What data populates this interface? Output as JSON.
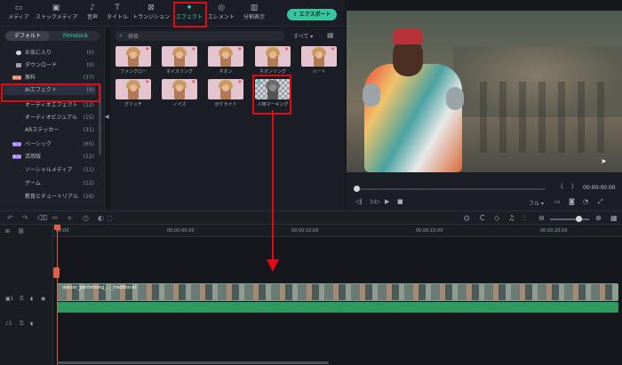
{
  "toolbar": {
    "items": [
      {
        "label": "メディア",
        "icon": "media-icon"
      },
      {
        "label": "ストックメディア",
        "icon": "stock-media-icon"
      },
      {
        "label": "音声",
        "icon": "audio-icon"
      },
      {
        "label": "タイトル",
        "icon": "title-icon"
      },
      {
        "label": "トランジション",
        "icon": "transition-icon"
      },
      {
        "label": "エフェクト",
        "icon": "effects-icon"
      },
      {
        "label": "エレメント",
        "icon": "elements-icon"
      },
      {
        "label": "分割表示",
        "icon": "split-screen-icon"
      }
    ],
    "active": "エフェクト",
    "export_label": "エクスポート"
  },
  "left_panel": {
    "tabs": [
      "デフォルト",
      "Filmstock"
    ],
    "categories": [
      {
        "name": "お気に入り",
        "count": "(0)"
      },
      {
        "name": "ダウンロード",
        "count": "(0)"
      },
      {
        "name": "無料",
        "count": "(37)",
        "badge": "NEW"
      },
      {
        "name": "AIエフェクト",
        "count": "(9)",
        "selected": true
      },
      {
        "name": "オーディオエフェクト",
        "count": "(12)"
      },
      {
        "name": "オーディオビジュアル",
        "count": "(15)"
      },
      {
        "name": "ARステッカー",
        "count": "(31)"
      },
      {
        "name": "ベーシック",
        "count": "(65)",
        "badge": "NEW"
      },
      {
        "name": "活用版",
        "count": "(12)",
        "badge": "NEW"
      },
      {
        "name": "ソーシャルメディア",
        "count": "(11)"
      },
      {
        "name": "ゲーム",
        "count": "(12)"
      },
      {
        "name": "教育とチュートリアル",
        "count": "(16)"
      }
    ]
  },
  "effects": {
    "search_placeholder": "検索",
    "filter_label": "すべて ▾",
    "items": [
      {
        "label": "ファンクロー"
      },
      {
        "label": "ホイスリング"
      },
      {
        "label": "ネオン"
      },
      {
        "label": "ネオンリング"
      },
      {
        "label": "ハート"
      },
      {
        "label": "グリッチ"
      },
      {
        "label": "ノイズ"
      },
      {
        "label": "ボケライト"
      },
      {
        "label": "人物マーキング"
      }
    ]
  },
  "player": {
    "timecode": "00:00:00:00",
    "quality": "フル ▾"
  },
  "timeline": {
    "ticks": [
      "00:00",
      "00:00:05:00",
      "00:00:10:00",
      "00:00:15:00",
      "00:00:20:00"
    ],
    "clip_name": "dancer_performing_..._traditional"
  },
  "colors": {
    "accent": "#3fd7b3",
    "export": "#36c79f",
    "annotation": "#e10b17",
    "audio_track": "#2f9a5f",
    "playhead": "#e0614a"
  }
}
